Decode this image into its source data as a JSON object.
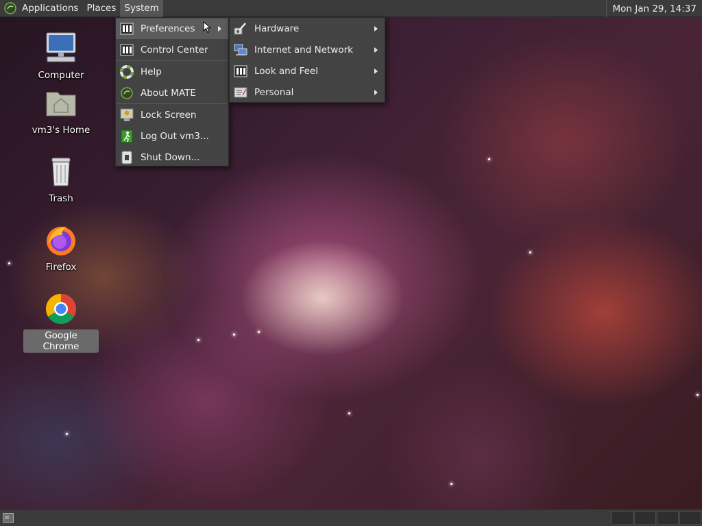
{
  "top_panel": {
    "menus": {
      "applications": "Applications",
      "places": "Places",
      "system": "System"
    },
    "clock": "Mon Jan 29, 14:37"
  },
  "desktop_icons": {
    "computer": "Computer",
    "home": "vm3's Home",
    "trash": "Trash",
    "firefox": "Firefox",
    "chrome": "Google Chrome"
  },
  "system_menu": {
    "preferences": "Preferences",
    "control_center": "Control Center",
    "help": "Help",
    "about": "About MATE",
    "lock_screen": "Lock Screen",
    "log_out": "Log Out vm3...",
    "shut_down": "Shut Down..."
  },
  "preferences_submenu": {
    "hardware": "Hardware",
    "internet_network": "Internet and Network",
    "look_feel": "Look and Feel",
    "personal": "Personal"
  },
  "colors": {
    "panel": "#3b3b3b",
    "menu": "#434343",
    "menu_highlight": "#5c5c5c"
  }
}
